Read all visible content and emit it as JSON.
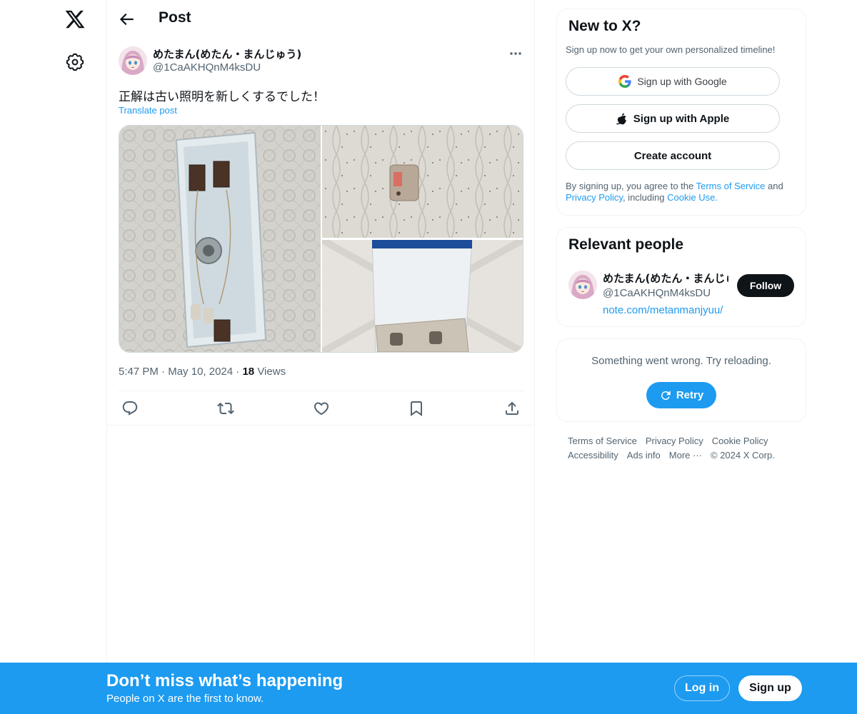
{
  "header": {
    "title": "Post"
  },
  "post": {
    "author_name": "めたまん(めたん・まんじゅう)",
    "author_handle": "@1CaAKHQnM4ksDU",
    "text": "正解は古い照明を新しくするでした！",
    "translate_label": "Translate post",
    "time": "5:47 PM",
    "date": "May 10, 2024",
    "views_count": "18",
    "views_label": "Views",
    "separator": "·"
  },
  "new_to_x": {
    "title": "New to X?",
    "subtitle": "Sign up now to get your own personalized timeline!",
    "google_label": "Sign up with Google",
    "apple_label": "Sign up with Apple",
    "create_label": "Create account",
    "legal_prefix": "By signing up, you agree to the ",
    "terms_link": "Terms of Service",
    "legal_and": " and ",
    "privacy_link": "Privacy Policy",
    "legal_including": ", including ",
    "cookie_link": "Cookie Use."
  },
  "relevant_people": {
    "title": "Relevant people",
    "name": "めたまん(めたん・まんじゅう)",
    "handle": "@1CaAKHQnM4ksDU",
    "link": "note.com/metanmanjyuu/",
    "follow_label": "Follow"
  },
  "error_card": {
    "message": "Something went wrong. Try reloading.",
    "retry_label": "Retry"
  },
  "footer": {
    "terms": "Terms of Service",
    "privacy": "Privacy Policy",
    "cookie": "Cookie Policy",
    "accessibility": "Accessibility",
    "ads": "Ads info",
    "more": "More ···",
    "copyright": "© 2024 X Corp."
  },
  "banner": {
    "title": "Don’t miss what’s happening",
    "subtitle": "People on X are the first to know.",
    "login_label": "Log in",
    "signup_label": "Sign up"
  },
  "colors": {
    "accent": "#1d9bf0",
    "text_primary": "#0f1419",
    "text_secondary": "#536471",
    "border": "#eff3f4"
  },
  "icons": [
    "x-logo-icon",
    "gear-icon",
    "back-arrow-icon",
    "more-icon",
    "reply-icon",
    "repost-icon",
    "like-icon",
    "bookmark-icon",
    "share-icon",
    "google-icon",
    "apple-icon",
    "refresh-icon"
  ]
}
